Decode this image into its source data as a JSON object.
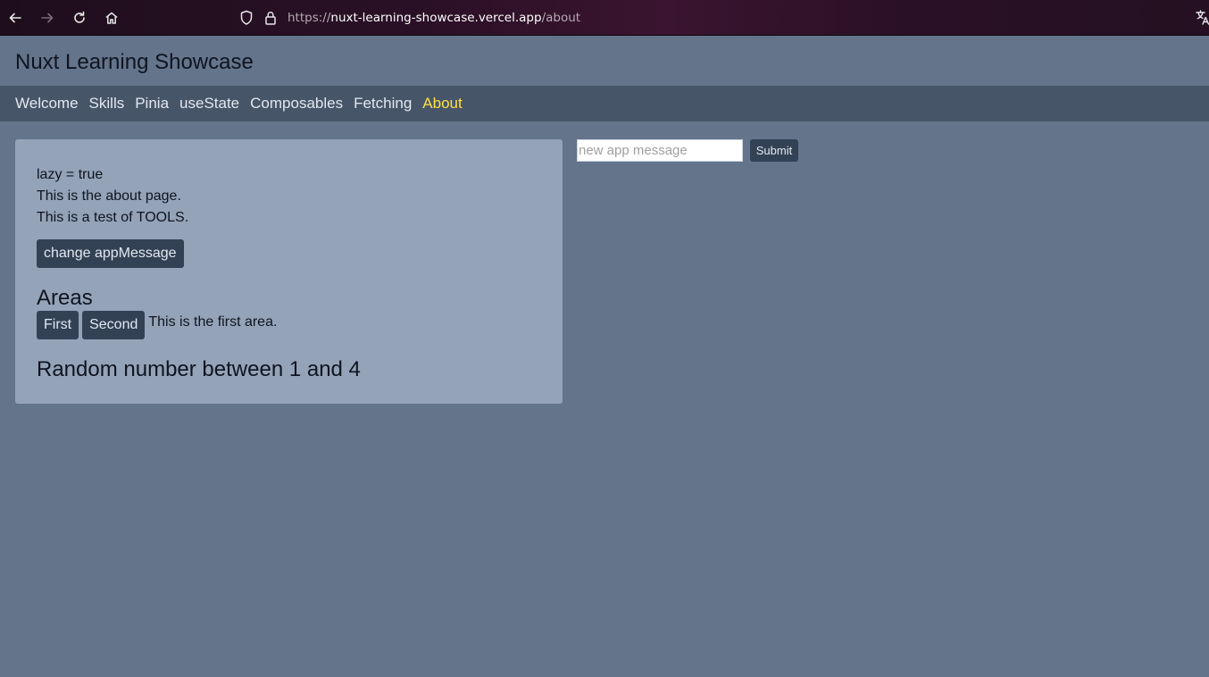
{
  "browser": {
    "url_prefix": "https://",
    "url_host": "nuxt-learning-showcase.vercel.app",
    "url_path": "/about",
    "icons": [
      "back-icon",
      "forward-icon",
      "reload-icon",
      "home-icon",
      "shield-icon",
      "lock-icon",
      "translate-icon"
    ]
  },
  "header": {
    "title": "Nuxt Learning Showcase"
  },
  "nav": {
    "items": [
      {
        "label": "Welcome"
      },
      {
        "label": "Skills"
      },
      {
        "label": "Pinia"
      },
      {
        "label": "useState"
      },
      {
        "label": "Composables"
      },
      {
        "label": "Fetching"
      },
      {
        "label": "About",
        "active": true
      }
    ]
  },
  "card": {
    "lazy_line": "lazy = true",
    "about_line": "This is the about page.",
    "tools_line": "This is a test of TOOLS.",
    "change_button": "change appMessage",
    "areas_title": "Areas",
    "area_first": "First",
    "area_second": "Second",
    "area_text": "This is the first area.",
    "random_title": "Random number between 1 and 4"
  },
  "message_form": {
    "placeholder": "new app message",
    "value": "",
    "submit_label": "Submit"
  },
  "colors": {
    "page_bg": "#64748b",
    "nav_bg": "#475569",
    "card_bg": "#94a3b8",
    "button_bg": "#334155",
    "active_nav": "#fde047"
  }
}
